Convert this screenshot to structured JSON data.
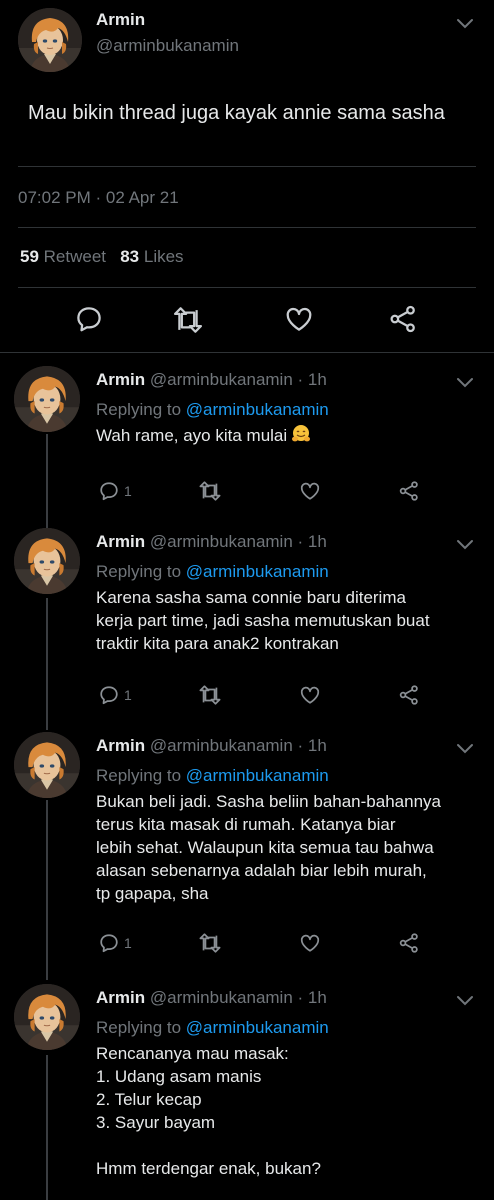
{
  "main_tweet": {
    "name": "Armin",
    "handle": "@arminbukanamin",
    "text": "Mau bikin thread juga kayak annie sama sasha",
    "timestamp": "07:02 PM · 02 Apr 21",
    "retweets_count": "59",
    "retweets_label": "Retweet",
    "likes_count": "83",
    "likes_label": "Likes"
  },
  "replies": [
    {
      "name": "Armin",
      "handle_time": "@arminbukanamin · 1h",
      "replying_label": "Replying to",
      "replying_to": "@arminbukanamin",
      "text": "Wah rame, ayo kita mulai",
      "emoji": "hugging-face",
      "reply_count": "1"
    },
    {
      "name": "Armin",
      "handle_time": "@arminbukanamin · 1h",
      "replying_label": "Replying to",
      "replying_to": "@arminbukanamin",
      "text": "Karena sasha sama connie baru diterima\nkerja part time, jadi sasha memutuskan buat\ntraktir kita para anak2 kontrakan",
      "reply_count": "1"
    },
    {
      "name": "Armin",
      "handle_time": "@arminbukanamin · 1h",
      "replying_label": "Replying to",
      "replying_to": "@arminbukanamin",
      "text": "Bukan beli jadi. Sasha beliin bahan-bahannya\nterus kita masak di rumah. Katanya biar\nlebih sehat. Walaupun kita semua tau bahwa\nalasan sebenarnya adalah biar lebih murah,\ntp gapapa, sha",
      "reply_count": "1"
    },
    {
      "name": "Armin",
      "handle_time": "@arminbukanamin · 1h",
      "replying_label": "Replying to",
      "replying_to": "@arminbukanamin",
      "text": "Rencananya mau masak:\n1. Udang asam manis\n2. Telur kecap\n3. Sayur bayam\n\nHmm terdengar enak, bukan?"
    }
  ],
  "colors": {
    "background": "#000000",
    "text": "#e7e9ea",
    "muted": "#71767b",
    "link": "#1d9bf0",
    "divider": "#2f3336"
  }
}
